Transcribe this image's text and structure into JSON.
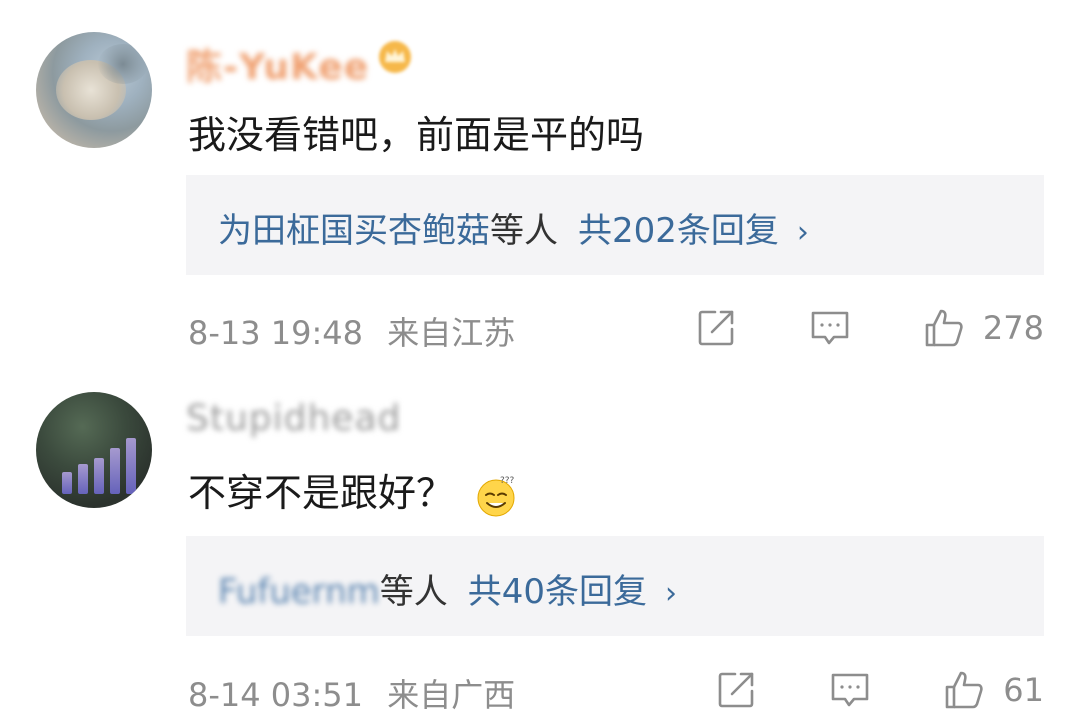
{
  "comments": [
    {
      "username": "陈-YuKee",
      "text": "我没看错吧，前面是平的吗",
      "reply": {
        "names": "为田柾国买杏鲍菇",
        "suffix": "等人",
        "count": "共202条回复",
        "chevron": "›"
      },
      "time": "8-13 19:48",
      "location": "来自江苏",
      "likes": "278",
      "badge_icon": "crown-icon"
    },
    {
      "username": "Stupidhead",
      "text": "不穿不是跟好？",
      "emoji_icon": "thinking-emoji-icon",
      "reply": {
        "names": "Fufuernm",
        "suffix": "等人",
        "count": "共40条回复",
        "chevron": "›"
      },
      "time": "8-14 03:51",
      "location": "来自广西",
      "likes": "61"
    }
  ],
  "colors": {
    "reply_blue": "#3b6a9a",
    "meta_gray": "#8d8d8d",
    "reply_bg": "#f4f4f6",
    "username_orange": "#f0a273"
  }
}
